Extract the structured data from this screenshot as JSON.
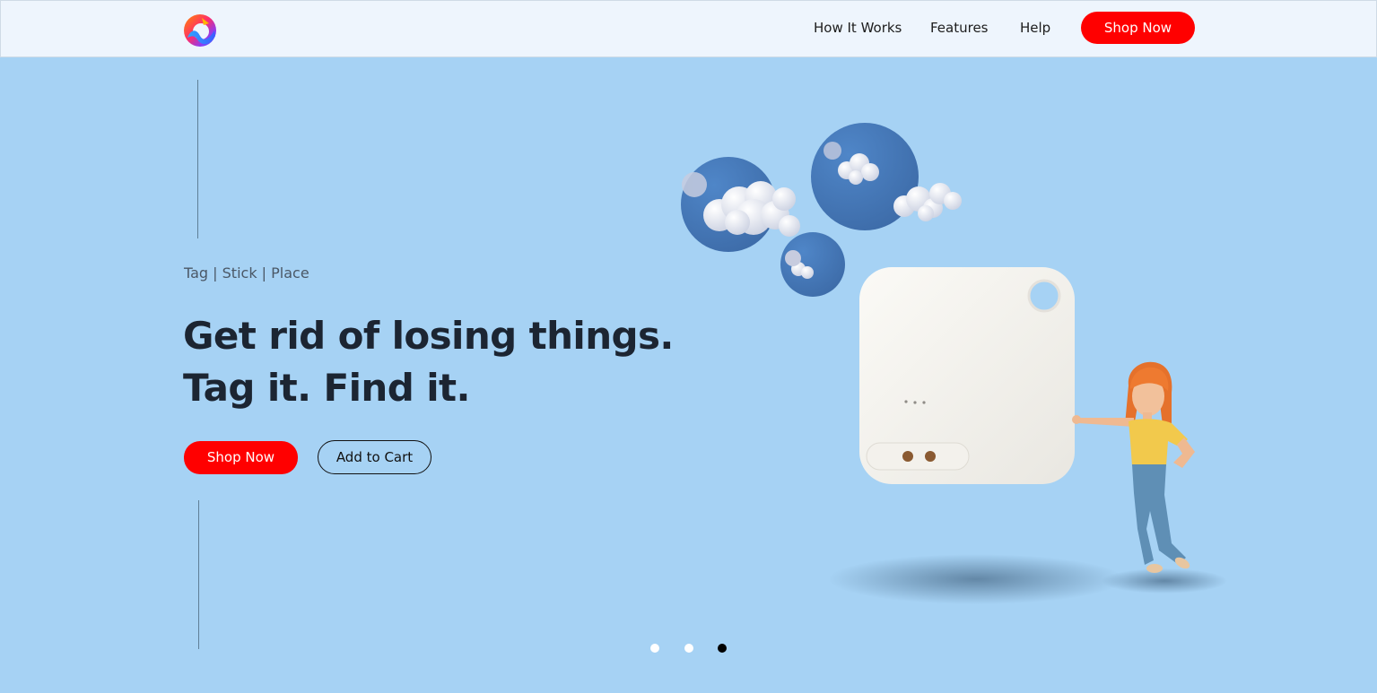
{
  "nav": {
    "links": [
      {
        "label": "How It Works"
      },
      {
        "label": "Features"
      },
      {
        "label": "Help"
      }
    ],
    "shop_label": "Shop Now"
  },
  "hero": {
    "tagline": "Tag | Stick | Place",
    "headline_line1": "Get rid of losing things.",
    "headline_line2": "Tag it. Find it.",
    "primary_button": "Shop Now",
    "secondary_button": "Add to Cart"
  },
  "carousel": {
    "total_slides": 3,
    "active_slide": 3
  },
  "colors": {
    "accent": "#ff0000",
    "hero_background": "#a6d2f4",
    "header_background": "#eef5fd",
    "headline": "#1c2532",
    "dot_active": "#000000",
    "dot_inactive": "#ffffff"
  },
  "icons": {
    "logo": "brand-logo-icon"
  }
}
